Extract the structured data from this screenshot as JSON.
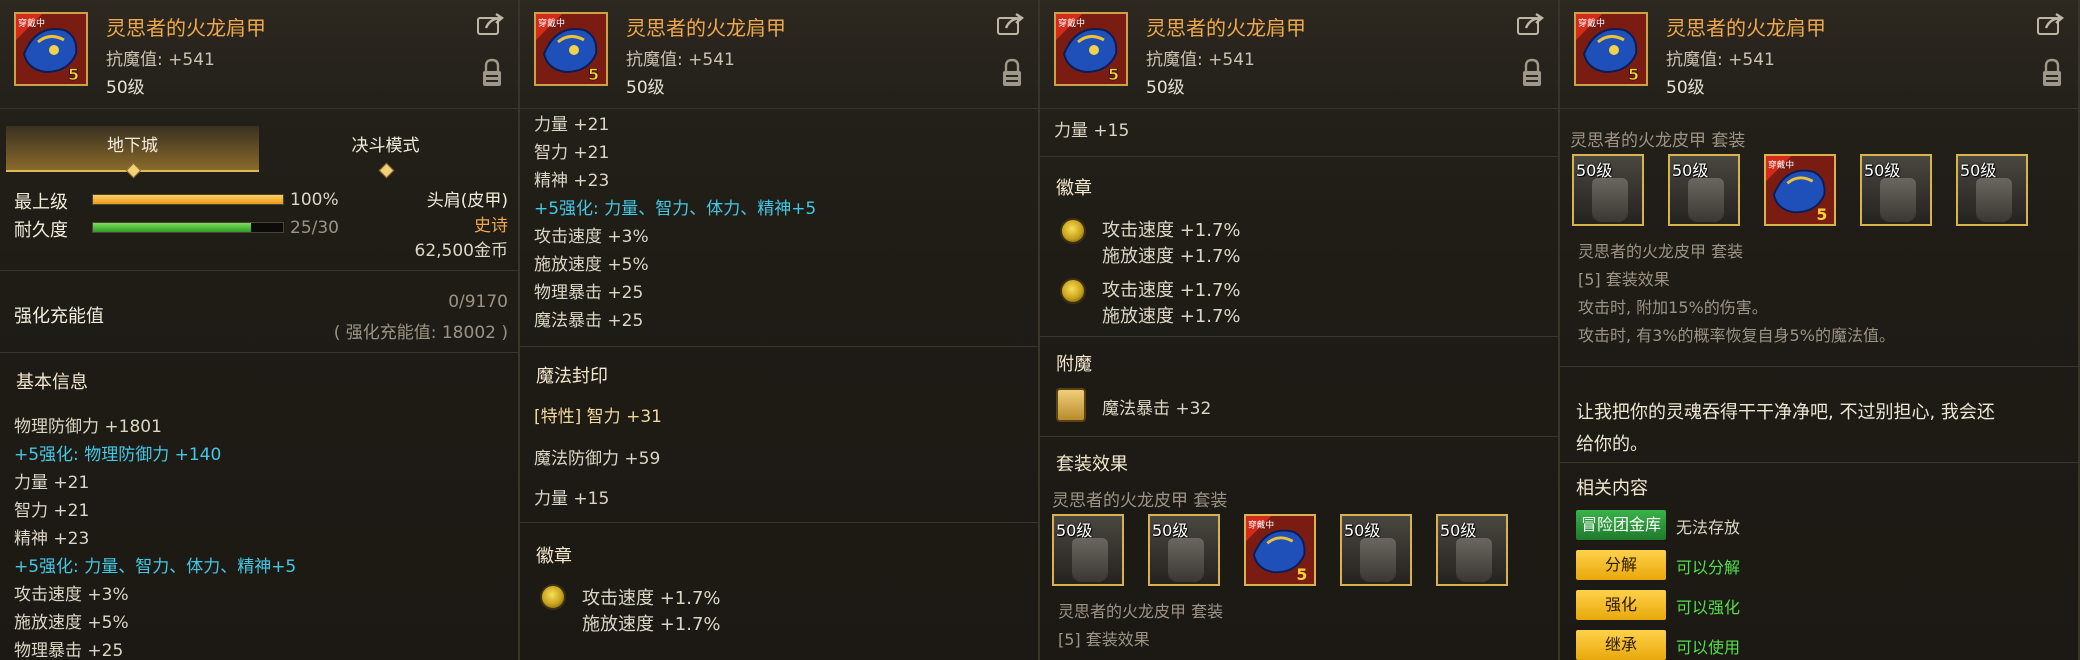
{
  "item": {
    "name": "灵思者的火龙肩甲",
    "stat": "抗魔值: +541",
    "level": "50级",
    "badge": "穿戴中",
    "icon_tier": "5"
  },
  "panel1": {
    "tabs": [
      "地下城",
      "决斗模式"
    ],
    "grade_label": "最上级",
    "grade_value": "100%",
    "durability_label": "耐久度",
    "durability_value": "25/30",
    "grade_fraction": 1.0,
    "durability_fraction": 0.833,
    "slot_type": "头肩(皮甲)",
    "rarity": "史诗",
    "price": "62,500金币",
    "enhance_title": "强化充能值",
    "enhance_value": "0/9170",
    "enhance_total": "( 强化充能值: 18002 )",
    "basic_title": "基本信息",
    "lines": [
      {
        "text": "物理防御力 +1801",
        "color": "normal"
      },
      {
        "text": "+5强化: 物理防御力 +140",
        "color": "cyan"
      },
      {
        "text": "力量 +21",
        "color": "normal"
      },
      {
        "text": "智力 +21",
        "color": "normal"
      },
      {
        "text": "精神 +23",
        "color": "normal"
      },
      {
        "text": "+5强化: 力量、智力、体力、精神+5",
        "color": "cyan"
      },
      {
        "text": "攻击速度 +3%",
        "color": "normal"
      },
      {
        "text": "施放速度 +5%",
        "color": "normal"
      },
      {
        "text": "物理暴击 +25",
        "color": "normal"
      }
    ]
  },
  "panel2": {
    "lines": [
      {
        "text": "力量 +21",
        "color": "normal"
      },
      {
        "text": "智力 +21",
        "color": "normal"
      },
      {
        "text": "精神 +23",
        "color": "normal"
      },
      {
        "text": "+5强化: 力量、智力、体力、精神+5",
        "color": "cyan"
      },
      {
        "text": "攻击速度 +3%",
        "color": "normal"
      },
      {
        "text": "施放速度 +5%",
        "color": "normal"
      },
      {
        "text": "物理暴击 +25",
        "color": "normal"
      },
      {
        "text": "魔法暴击 +25",
        "color": "normal"
      }
    ],
    "seal_title": "魔法封印",
    "seal_trait": "[特性] 智力 +31",
    "seal_line2": "魔法防御力 +59",
    "seal_line3": "力量 +15",
    "emblem_title": "徽章",
    "emblem1_line1": "攻击速度 +1.7%",
    "emblem1_line2": "施放速度 +1.7%"
  },
  "panel3": {
    "top_line": "力量 +15",
    "emblem_title": "徽章",
    "emblem1_line1": "攻击速度 +1.7%",
    "emblem1_line2": "施放速度 +1.7%",
    "emblem2_line1": "攻击速度 +1.7%",
    "emblem2_line2": "施放速度 +1.7%",
    "enchant_title": "附魔",
    "enchant_line": "魔法暴击 +32",
    "set_title": "套装效果",
    "set_name": "灵思者的火龙皮甲  套装",
    "slots": [
      "50级",
      "50级",
      "",
      "50级",
      "50级"
    ],
    "set_sub": "灵思者的火龙皮甲  套装",
    "set_effect": "[5] 套装效果"
  },
  "panel4": {
    "set_name": "灵思者的火龙皮甲  套装",
    "slots": [
      "50级",
      "50级",
      "",
      "50级",
      "50级"
    ],
    "set_sub": "灵思者的火龙皮甲  套装",
    "set_effect": "[5] 套装效果",
    "effect1": "攻击时, 附加15%的伤害。",
    "effect2": "攻击时, 有3%的概率恢复自身5%的魔法值。",
    "quote1": "让我把你的灵魂吞得干干净净吧, 不过别担心, 我会还",
    "quote2": "给你的。",
    "related_title": "相关内容",
    "storage_btn": "冒险团金库",
    "storage_text": "无法存放",
    "disassemble_btn": "分解",
    "disassemble_text": "可以分解",
    "enhance_btn": "强化",
    "enhance_text": "可以强化",
    "inherit_btn": "继承",
    "inherit_text": "可以使用"
  },
  "colors": {
    "name": "#f0a84a",
    "cyan": "#43c8e6",
    "gold": "#e0b955",
    "green": "#52e04a"
  }
}
